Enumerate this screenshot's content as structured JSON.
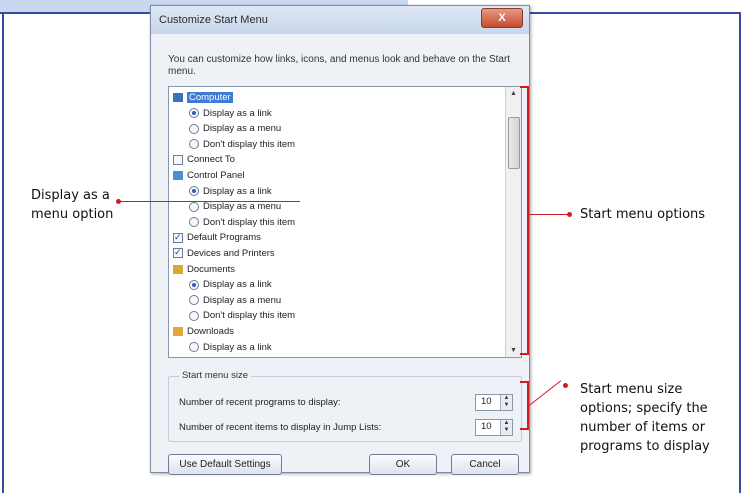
{
  "dialog": {
    "title": "Customize Start Menu",
    "close_label": "X",
    "description": "You can customize how links, icons, and menus look and behave on the Start menu.",
    "list_items": [
      {
        "kind": "icon",
        "icon": "computer-icon",
        "label": "Computer",
        "selected": true
      },
      {
        "kind": "radio",
        "label": "Display as a link",
        "checked": true
      },
      {
        "kind": "radio",
        "label": "Display as a menu",
        "checked": false
      },
      {
        "kind": "radio",
        "label": "Don't display this item",
        "checked": false
      },
      {
        "kind": "checkbox",
        "label": "Connect To",
        "checked": false
      },
      {
        "kind": "icon",
        "icon": "control-panel-icon",
        "label": "Control Panel"
      },
      {
        "kind": "radio",
        "label": "Display as a link",
        "checked": true
      },
      {
        "kind": "radio",
        "label": "Display as a menu",
        "checked": false
      },
      {
        "kind": "radio",
        "label": "Don't display this item",
        "checked": false
      },
      {
        "kind": "checkbox",
        "label": "Default Programs",
        "checked": true
      },
      {
        "kind": "checkbox",
        "label": "Devices and Printers",
        "checked": true
      },
      {
        "kind": "icon",
        "icon": "documents-icon",
        "label": "Documents"
      },
      {
        "kind": "radio",
        "label": "Display as a link",
        "checked": true
      },
      {
        "kind": "radio",
        "label": "Display as a menu",
        "checked": false
      },
      {
        "kind": "radio",
        "label": "Don't display this item",
        "checked": false
      },
      {
        "kind": "icon",
        "icon": "downloads-icon",
        "label": "Downloads"
      },
      {
        "kind": "radio",
        "label": "Display as a link",
        "checked": false
      }
    ],
    "size_group": {
      "title": "Start menu size",
      "programs_label": "Number of recent programs to display:",
      "programs_value": "10",
      "jump_label": "Number of recent items to display in Jump Lists:",
      "jump_value": "10"
    },
    "buttons": {
      "defaults": "Use Default Settings",
      "ok": "OK",
      "cancel": "Cancel"
    }
  },
  "callouts": {
    "left": "Display as a menu option",
    "right_top": "Start menu options",
    "right_bottom": "Start menu size options; specify the number of items or programs to display"
  },
  "colors": {
    "callout_line": "#d21a22",
    "frame_border": "#3a4aa0",
    "selection": "#3d7bd4"
  }
}
